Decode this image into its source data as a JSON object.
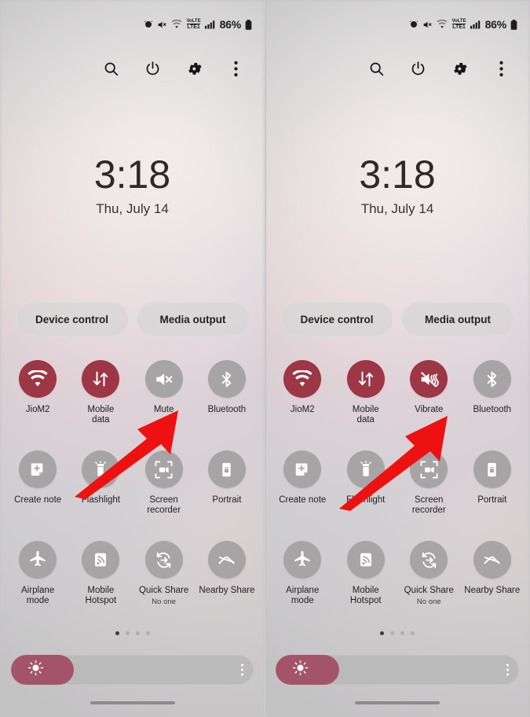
{
  "status_bar": {
    "icons": [
      "alarm-icon",
      "sound-off-icon",
      "wifi-icon",
      "volte-icon",
      "signal-icon"
    ],
    "volte_top": "VoLTE",
    "volte_bottom": "LTE1",
    "battery_percent": "86%",
    "battery_icon": "battery-icon"
  },
  "icon_bar": {
    "items": [
      {
        "name": "search-icon",
        "label": "Search"
      },
      {
        "name": "power-icon",
        "label": "Power"
      },
      {
        "name": "settings-gear-icon",
        "label": "Settings"
      },
      {
        "name": "more-options-icon",
        "label": "More options"
      }
    ]
  },
  "clock": {
    "time": "3:18",
    "date": "Thu, July 14"
  },
  "pills": {
    "device_control": "Device control",
    "media_output": "Media output"
  },
  "left_panel": {
    "tiles": [
      {
        "label": "JioM2",
        "sub": "",
        "icon": "wifi-icon",
        "state": "on"
      },
      {
        "label": "Mobile\ndata",
        "sub": "",
        "icon": "mobile-data-icon",
        "state": "on"
      },
      {
        "label": "Mute",
        "sub": "",
        "icon": "mute-icon",
        "state": "off"
      },
      {
        "label": "Bluetooth",
        "sub": "",
        "icon": "bluetooth-icon",
        "state": "off"
      },
      {
        "label": "Create note",
        "sub": "",
        "icon": "create-note-icon",
        "state": "off"
      },
      {
        "label": "Flashlight",
        "sub": "",
        "icon": "flashlight-icon",
        "state": "off"
      },
      {
        "label": "Screen\nrecorder",
        "sub": "",
        "icon": "screen-recorder-icon",
        "state": "off"
      },
      {
        "label": "Portrait",
        "sub": "",
        "icon": "rotation-lock-icon",
        "state": "off"
      },
      {
        "label": "Airplane\nmode",
        "sub": "",
        "icon": "airplane-icon",
        "state": "off"
      },
      {
        "label": "Mobile\nHotspot",
        "sub": "",
        "icon": "hotspot-icon",
        "state": "off"
      },
      {
        "label": "Quick Share",
        "sub": "No one",
        "icon": "quick-share-icon",
        "state": "off"
      },
      {
        "label": "Nearby Share",
        "sub": "",
        "icon": "nearby-share-icon",
        "state": "off"
      }
    ]
  },
  "right_panel": {
    "tiles": [
      {
        "label": "JioM2",
        "sub": "",
        "icon": "wifi-icon",
        "state": "on"
      },
      {
        "label": "Mobile\ndata",
        "sub": "",
        "icon": "mobile-data-icon",
        "state": "on"
      },
      {
        "label": "Vibrate",
        "sub": "",
        "icon": "vibrate-icon",
        "state": "on"
      },
      {
        "label": "Bluetooth",
        "sub": "",
        "icon": "bluetooth-icon",
        "state": "off"
      },
      {
        "label": "Create note",
        "sub": "",
        "icon": "create-note-icon",
        "state": "off"
      },
      {
        "label": "Flashlight",
        "sub": "",
        "icon": "flashlight-icon",
        "state": "off"
      },
      {
        "label": "Screen\nrecorder",
        "sub": "",
        "icon": "screen-recorder-icon",
        "state": "off"
      },
      {
        "label": "Portrait",
        "sub": "",
        "icon": "rotation-lock-icon",
        "state": "off"
      },
      {
        "label": "Airplane\nmode",
        "sub": "",
        "icon": "airplane-icon",
        "state": "off"
      },
      {
        "label": "Mobile\nHotspot",
        "sub": "",
        "icon": "hotspot-icon",
        "state": "off"
      },
      {
        "label": "Quick Share",
        "sub": "No one",
        "icon": "quick-share-icon",
        "state": "off"
      },
      {
        "label": "Nearby Share",
        "sub": "",
        "icon": "nearby-share-icon",
        "state": "off"
      }
    ]
  },
  "pager": {
    "count": 4,
    "active_index": 0
  },
  "brightness": {
    "value_percent": 26,
    "icon": "brightness-sun-icon",
    "more_icon": "more-options-icon"
  },
  "annotations": {
    "left_arrow": {
      "name": "red-arrow-pointing-to-mute",
      "color": "#ee1111",
      "target": "Mute"
    },
    "right_arrow": {
      "name": "red-arrow-pointing-to-vibrate",
      "color": "#ee1111",
      "target": "Vibrate"
    }
  },
  "colors": {
    "tile_active": "#9d3645",
    "tile_inactive": "#a6a4a5",
    "slider_fill": "#a4546a",
    "arrow_red": "#ee1111"
  }
}
